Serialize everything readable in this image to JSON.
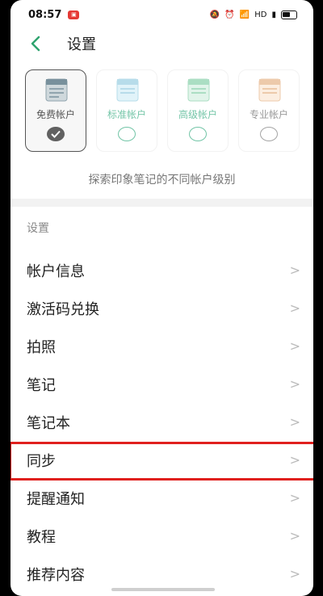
{
  "status_bar": {
    "time": "08:57",
    "network": "HD"
  },
  "header": {
    "title": "设置"
  },
  "tiers": [
    {
      "label": "免费帐户",
      "selected": true
    },
    {
      "label": "标准帐户",
      "selected": false
    },
    {
      "label": "高级帐户",
      "selected": false
    },
    {
      "label": "专业帐户",
      "selected": false
    }
  ],
  "tier_caption": "探索印象笔记的不同帐户级别",
  "section_label": "设置",
  "menu": [
    {
      "label": "帐户信息"
    },
    {
      "label": "激活码兑换"
    },
    {
      "label": "拍照"
    },
    {
      "label": "笔记"
    },
    {
      "label": "笔记本"
    },
    {
      "label": "同步"
    },
    {
      "label": "提醒通知"
    },
    {
      "label": "教程"
    },
    {
      "label": "推荐内容"
    }
  ],
  "colors": {
    "accent": "#45b28a",
    "highlight": "#e0201e"
  }
}
